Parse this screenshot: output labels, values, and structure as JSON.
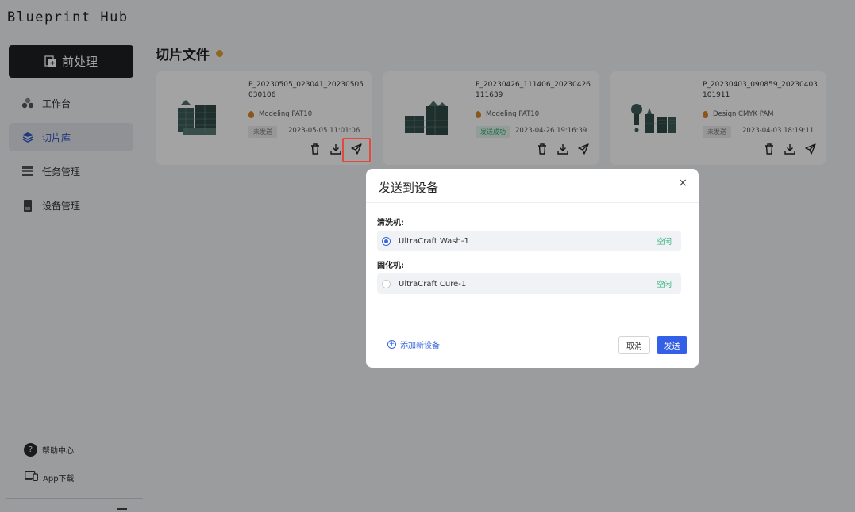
{
  "app": {
    "logo": "Blueprint Hub"
  },
  "sidebar": {
    "pre_button": "前处理",
    "items": [
      {
        "label": "工作台",
        "icon": "dashboard-icon",
        "active": false
      },
      {
        "label": "切片库",
        "icon": "layers-icon",
        "active": true
      },
      {
        "label": "任务管理",
        "icon": "task-list-icon",
        "active": false
      },
      {
        "label": "设备管理",
        "icon": "device-icon",
        "active": false
      }
    ],
    "help": "帮助中心",
    "app_download": "App下载"
  },
  "main": {
    "title": "切片文件",
    "cards": [
      {
        "filename": "P_20230505_023041_20230505030106",
        "material": "Modeling PAT10",
        "status": "未发送",
        "status_color": "grey",
        "date": "2023-05-05 11:01:06"
      },
      {
        "filename": "P_20230426_111406_20230426111639",
        "material": "Modeling PAT10",
        "status": "发送成功",
        "status_color": "green",
        "date": "2023-04-26 19:16:39"
      },
      {
        "filename": "P_20230403_090859_20230403101911",
        "material": "Design CMYK PAM",
        "status": "未发送",
        "status_color": "grey",
        "date": "2023-04-03 18:19:11"
      }
    ]
  },
  "modal": {
    "title": "发送到设备",
    "close": "×",
    "groups": [
      {
        "label": "清洗机:",
        "device": "UltraCraft Wash-1",
        "status": "空闲",
        "selected": true
      },
      {
        "label": "固化机:",
        "device": "UltraCraft Cure-1",
        "status": "空闲",
        "selected": false
      }
    ],
    "add_device": "添加新设备",
    "cancel": "取消",
    "send": "发送"
  },
  "colors": {
    "primary": "#3360e6",
    "idle_green": "#2cb07d",
    "highlight_red": "#e4473c",
    "dark_button": "#1f2022"
  }
}
